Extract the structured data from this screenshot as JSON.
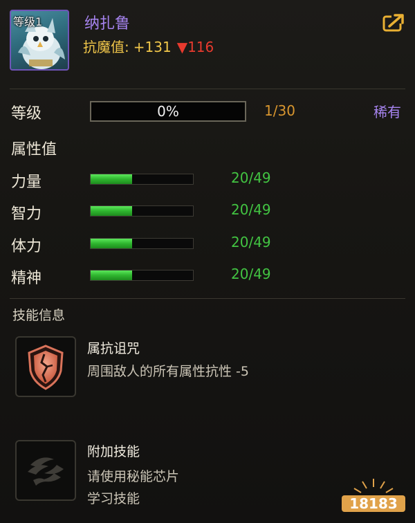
{
  "header": {
    "level_tag": "等级1",
    "character_name": "纳扎鲁",
    "resist_label": "抗魔值:",
    "resist_bonus": "+131",
    "resist_penalty_arrow": "▼",
    "resist_penalty": "116",
    "share_icon": "share-export-icon"
  },
  "level": {
    "label": "等级",
    "progress_text": "0%",
    "progress_fraction": 0.0,
    "count": "1/30",
    "rarity": "稀有"
  },
  "attributes": {
    "title": "属性值",
    "items": [
      {
        "name": "力量",
        "value": "20/49",
        "fraction": 0.408
      },
      {
        "name": "智力",
        "value": "20/49",
        "fraction": 0.408
      },
      {
        "name": "体力",
        "value": "20/49",
        "fraction": 0.408
      },
      {
        "name": "精神",
        "value": "20/49",
        "fraction": 0.408
      }
    ]
  },
  "skills": {
    "title": "技能信息",
    "items": [
      {
        "name": "属抗诅咒",
        "desc_line1": "周围敌人的所有属性抗性 -5",
        "desc_line2": "",
        "icon": "cracked-shield-icon"
      },
      {
        "name": "附加技能",
        "desc_line1": "请使用秘能芯片",
        "desc_line2": "学习技能",
        "icon": "claw-emblem-icon"
      }
    ]
  },
  "watermark": {
    "text": "18183"
  },
  "colors": {
    "accent_purple": "#a784f0",
    "gold": "#f0c64a",
    "red": "#e83a2e",
    "green": "#42c442",
    "orange": "#d9962f"
  }
}
